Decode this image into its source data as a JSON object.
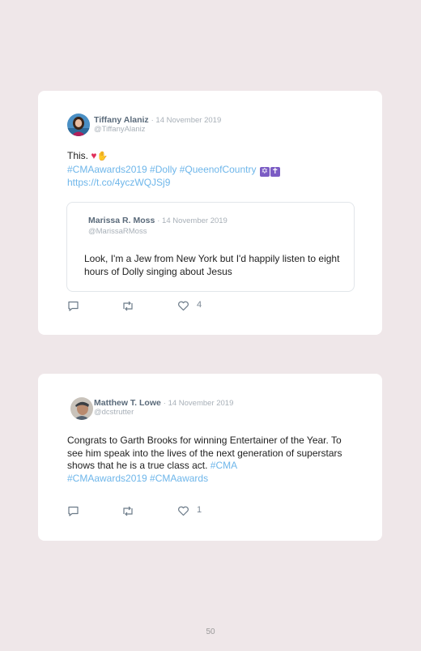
{
  "tweets": [
    {
      "name": "Tiffany Alaniz",
      "date": "14 November 2019",
      "handle": "@TiffanyAlaniz",
      "text_lead": "This.",
      "hashtags": "#CMAawards2019 #Dolly #QueenofCountry",
      "link": "https://t.co/4yczWQJSj9",
      "emoji": [
        "red-heart",
        "folded-hands",
        "star-of-david",
        "latin-cross"
      ],
      "quote": {
        "name": "Marissa R. Moss",
        "date": "14 November 2019",
        "handle": "@MarissaRMoss",
        "text": "Look, I'm a Jew from New York but I'd happily listen to eight hours of Dolly singing about Jesus"
      },
      "likes": "4"
    },
    {
      "name": "Matthew T. Lowe",
      "date": "14 November 2019",
      "handle": "@dcstrutter",
      "text": "Congrats to Garth Brooks for winning Entertainer of the Year. To see him speak into the lives of the next generation of superstars shows that he is a true class act.",
      "hashtag_inline": "#CMA",
      "hashtags": "#CMAawards2019 #CMAawards",
      "likes": "1"
    }
  ],
  "page_number": "50",
  "colors": {
    "hashtag": "#6eb6ea",
    "name": "#5a6a7a",
    "meta": "#a8b0b8",
    "background": "#efe7e9"
  }
}
